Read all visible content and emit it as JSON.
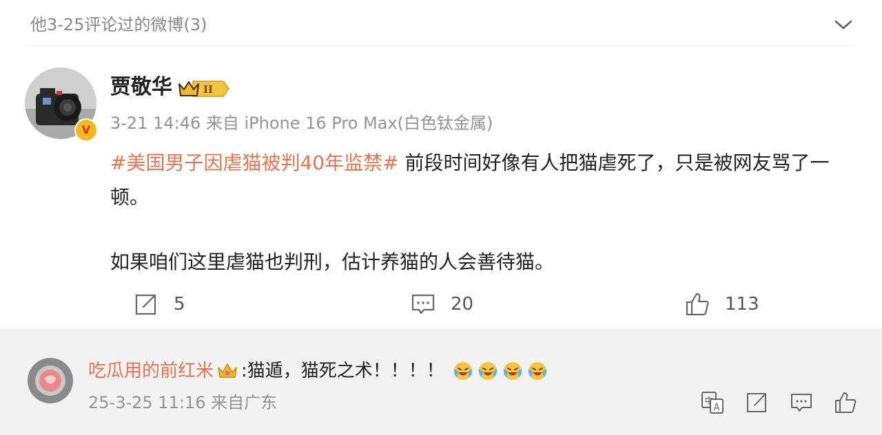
{
  "header": {
    "title": "他3-25评论过的微博(3)"
  },
  "post": {
    "author": "贾敬华",
    "badge_level": "II",
    "meta": "3-21 14:46  来自 iPhone 16 Pro Max(白色钛金属)",
    "topic": "#美国男子因虐猫被判40年监禁#",
    "text1": " 前段时间好像有人把猫虐死了，只是被网友骂了一顿。",
    "text2": "如果咱们这里虐猫也判刑，估计养猫的人会善待猫。",
    "actions": {
      "repost_count": "5",
      "comment_count": "20",
      "like_count": "113"
    }
  },
  "comment": {
    "author": "吃瓜用的前红米",
    "text": ":猫遁，猫死之术！！！！",
    "meta": "25-3-25 11:16  来自广东"
  },
  "colors": {
    "accent": "#eb7350",
    "muted": "#939393"
  }
}
